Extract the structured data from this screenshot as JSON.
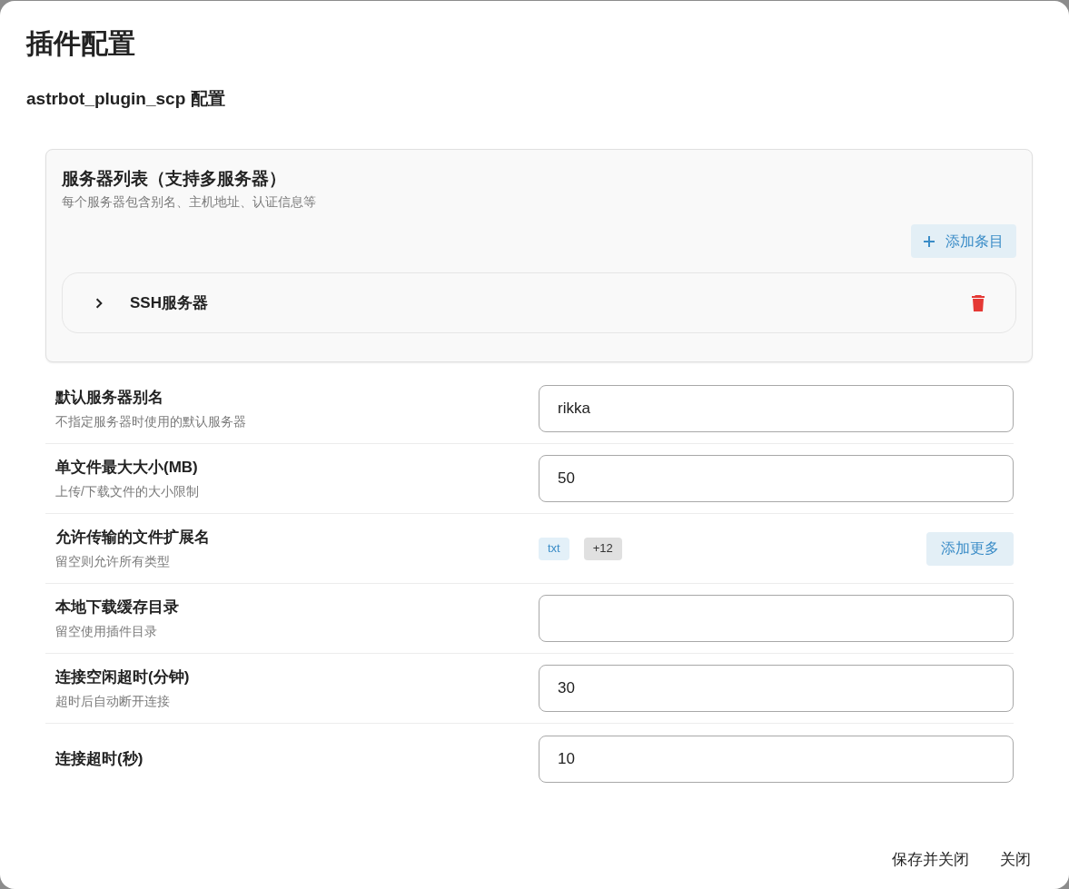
{
  "dialog": {
    "title": "插件配置",
    "subtitle": "astrbot_plugin_scp 配置"
  },
  "server_list": {
    "title": "服务器列表（支持多服务器）",
    "description": "每个服务器包含别名、主机地址、认证信息等",
    "add_button": "添加条目",
    "items": [
      {
        "title": "SSH服务器",
        "expanded": false
      }
    ]
  },
  "fields": [
    {
      "kind": "input",
      "label": "默认服务器别名",
      "description": "不指定服务器时使用的默认服务器",
      "value": "rikka"
    },
    {
      "kind": "input",
      "label": "单文件最大大小(MB)",
      "description": "上传/下载文件的大小限制",
      "value": "50"
    },
    {
      "kind": "tags",
      "label": "允许传输的文件扩展名",
      "description": "留空则允许所有类型",
      "tags": [
        "txt"
      ],
      "more_count": "+12",
      "add_button": "添加更多"
    },
    {
      "kind": "input",
      "label": "本地下载缓存目录",
      "description": "留空使用插件目录"
    },
    {
      "kind": "input",
      "label": "连接空闲超时(分钟)",
      "description": "超时后自动断开连接",
      "value": "30"
    },
    {
      "kind": "input",
      "label": "连接超时(秒)",
      "value": "10"
    }
  ],
  "footer": {
    "buttons": [
      "保存并关闭",
      "关闭"
    ]
  }
}
